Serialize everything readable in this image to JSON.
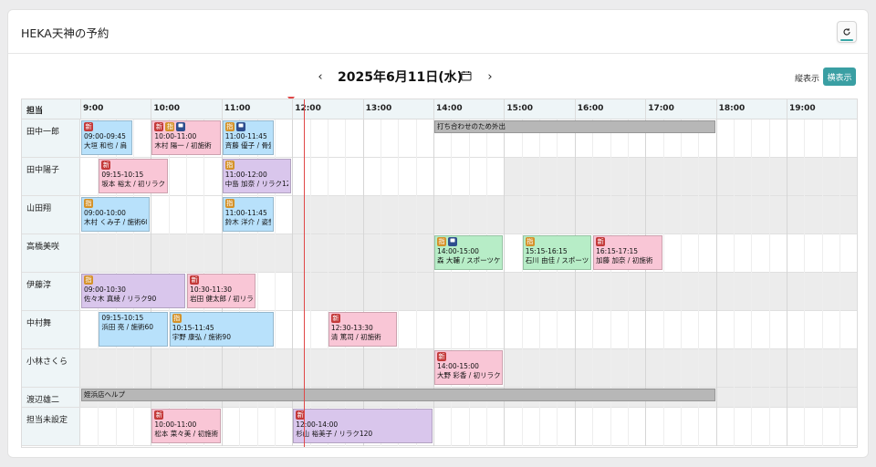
{
  "header": {
    "title": "HEKA天神の予約"
  },
  "nav": {
    "prev": "‹",
    "next": "›",
    "date": "2025年6月11日(水)"
  },
  "view": {
    "vertical": "縦表示",
    "horizontal": "横表示"
  },
  "grid": {
    "corner": "担当",
    "hours": [
      "9:00",
      "10:00",
      "11:00",
      "12:00",
      "13:00",
      "14:00",
      "15:00",
      "16:00",
      "17:00",
      "18:00",
      "19:00"
    ],
    "staff": [
      {
        "name": "田中一郎",
        "blocks": [],
        "events": [
          {
            "start": "09:00",
            "end": "09:45",
            "time": "09:00-09:45",
            "label": "大垣 和也 / 肩・",
            "color": "blue",
            "badges": [
              "新"
            ]
          },
          {
            "start": "10:00",
            "end": "11:00",
            "time": "10:00-11:00",
            "label": "木村 陽一 / 初施術",
            "color": "pink",
            "badges": [
              "新",
              "指",
              "chat"
            ]
          },
          {
            "start": "11:00",
            "end": "11:45",
            "time": "11:00-11:45",
            "label": "斉藤 優子 / 骨盤",
            "color": "blue",
            "badges": [
              "指",
              "chat"
            ]
          },
          {
            "start": "14:00",
            "end": "18:00",
            "time": "",
            "label": "打ち合わせのため外出",
            "color": "gray",
            "badges": []
          }
        ]
      },
      {
        "name": "田中陽子",
        "blocks": [
          [
            "15:00",
            "20:00"
          ]
        ],
        "events": [
          {
            "start": "09:15",
            "end": "10:15",
            "time": "09:15-10:15",
            "label": "坂本 裕太 / 初リラク",
            "color": "pink",
            "badges": [
              "新"
            ]
          },
          {
            "start": "11:00",
            "end": "12:00",
            "time": "11:00-12:00",
            "label": "中島 加奈 / リラク120",
            "color": "purple",
            "badges": [
              "指"
            ]
          }
        ]
      },
      {
        "name": "山田翔",
        "blocks": [
          [
            "12:00",
            "20:00"
          ]
        ],
        "events": [
          {
            "start": "09:00",
            "end": "10:00",
            "time": "09:00-10:00",
            "label": "木村 くみ子 / 施術60",
            "color": "blue",
            "badges": [
              "指"
            ]
          },
          {
            "start": "11:00",
            "end": "11:45",
            "time": "11:00-11:45",
            "label": "鈴木 洋介 / 姿勢",
            "color": "blue",
            "badges": [
              "指"
            ]
          }
        ]
      },
      {
        "name": "高橋美咲",
        "blocks": [
          [
            "09:00",
            "14:00"
          ]
        ],
        "events": [
          {
            "start": "14:00",
            "end": "15:00",
            "time": "14:00-15:00",
            "label": "森 大輔 / スポーツケア",
            "color": "green",
            "badges": [
              "指",
              "chat"
            ]
          },
          {
            "start": "15:15",
            "end": "16:15",
            "time": "15:15-16:15",
            "label": "石川 由佳 / スポーツケア",
            "color": "green",
            "badges": [
              "指"
            ]
          },
          {
            "start": "16:15",
            "end": "17:15",
            "time": "16:15-17:15",
            "label": "加藤 加奈 / 初施術",
            "color": "pink",
            "badges": [
              "新"
            ]
          }
        ]
      },
      {
        "name": "伊藤淳",
        "blocks": [
          [
            "12:00",
            "20:00"
          ]
        ],
        "events": [
          {
            "start": "09:00",
            "end": "10:30",
            "time": "09:00-10:30",
            "label": "佐々木 真綾 / リラク90",
            "color": "purple",
            "badges": [
              "指"
            ]
          },
          {
            "start": "10:30",
            "end": "11:30",
            "time": "10:30-11:30",
            "label": "岩田 健太郎 / 初リラク",
            "color": "pink",
            "badges": [
              "新"
            ]
          }
        ]
      },
      {
        "name": "中村舞",
        "blocks": [],
        "events": [
          {
            "start": "09:15",
            "end": "10:15",
            "time": "09:15-10:15",
            "label": "浜田 亮 / 施術60",
            "color": "blue",
            "badges": []
          },
          {
            "start": "10:15",
            "end": "11:45",
            "time": "10:15-11:45",
            "label": "宇野 康弘 / 施術90",
            "color": "blue",
            "badges": [
              "指"
            ]
          },
          {
            "start": "12:30",
            "end": "13:30",
            "time": "12:30-13:30",
            "label": "清 篤司 / 初施術",
            "color": "pink",
            "badges": [
              "新"
            ]
          }
        ]
      },
      {
        "name": "小林さくら",
        "blocks": [
          [
            "09:00",
            "14:00"
          ],
          [
            "15:00",
            "20:00"
          ]
        ],
        "events": [
          {
            "start": "14:00",
            "end": "15:00",
            "time": "14:00-15:00",
            "label": "大野 彩香 / 初リラク",
            "color": "pink",
            "badges": [
              "新"
            ]
          }
        ]
      },
      {
        "name": "渡辺雄二",
        "blocks": [
          [
            "09:00",
            "20:00"
          ]
        ],
        "events": [
          {
            "start": "09:00",
            "end": "18:00",
            "time": "",
            "label": "姪浜店ヘルプ",
            "color": "gray",
            "badges": []
          }
        ]
      },
      {
        "name": "担当未設定",
        "blocks": [],
        "events": [
          {
            "start": "10:00",
            "end": "11:00",
            "time": "10:00-11:00",
            "label": "松本 菜々美 / 初施術",
            "color": "pink",
            "badges": [
              "新"
            ]
          },
          {
            "start": "12:00",
            "end": "14:00",
            "time": "12:00-14:00",
            "label": "杉山 裕美子 / リラク120",
            "color": "purple",
            "badges": [
              "新"
            ]
          }
        ]
      }
    ]
  }
}
